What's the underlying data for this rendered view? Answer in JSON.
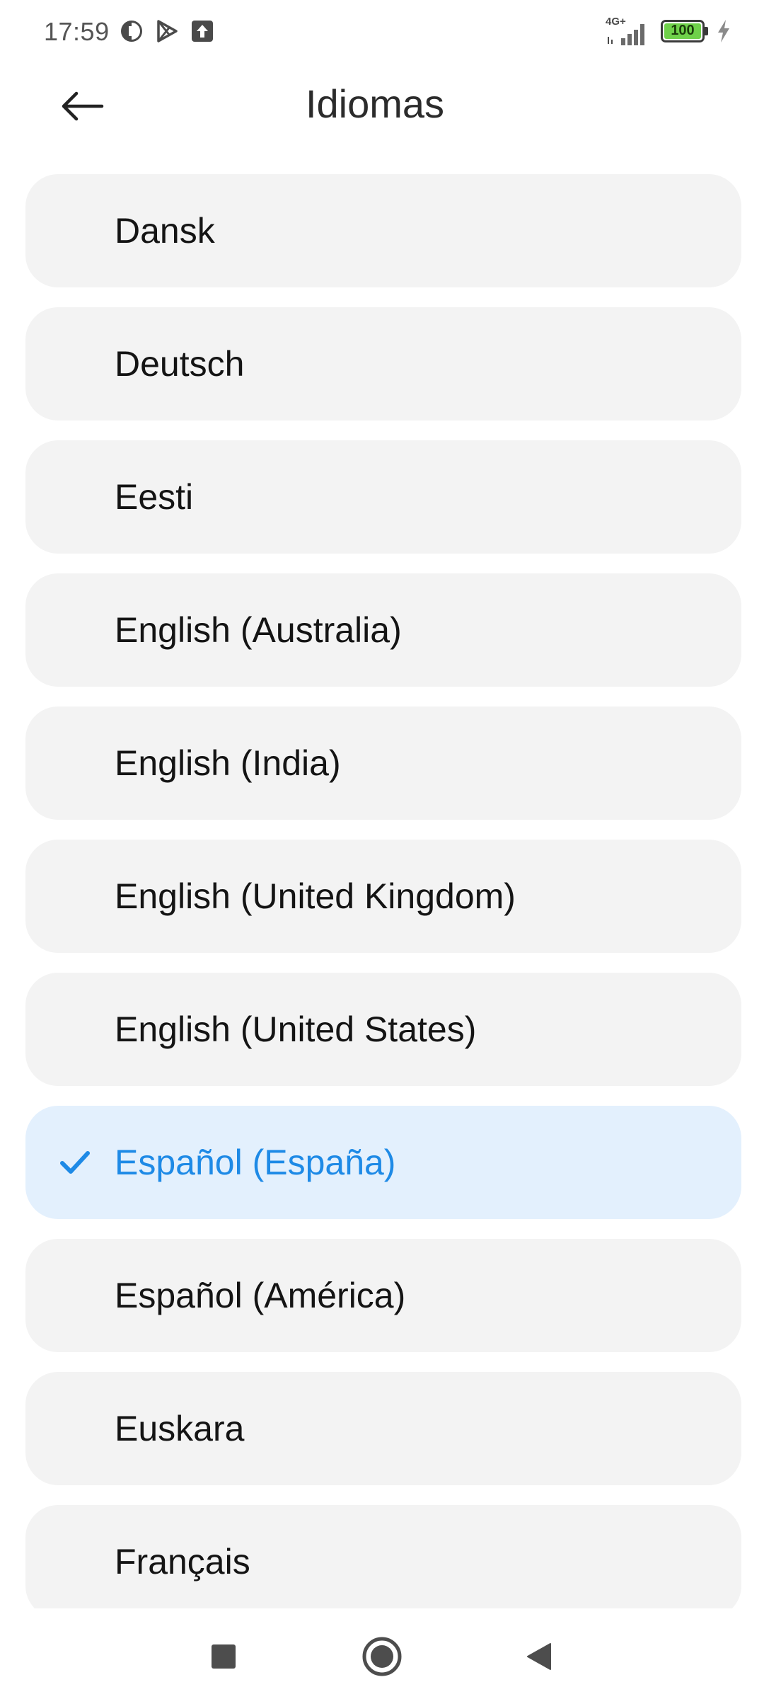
{
  "status_bar": {
    "time": "17:59",
    "network": "4G+",
    "battery": "100",
    "icons": [
      "app-notification-icon",
      "play-store-icon",
      "upload-icon",
      "signal-icon",
      "battery-icon",
      "charging-icon"
    ]
  },
  "header": {
    "title": "Idiomas",
    "back_icon": "arrow-left-icon"
  },
  "languages": [
    {
      "label": "Dansk",
      "selected": false
    },
    {
      "label": "Deutsch",
      "selected": false
    },
    {
      "label": "Eesti",
      "selected": false
    },
    {
      "label": "English (Australia)",
      "selected": false
    },
    {
      "label": "English (India)",
      "selected": false
    },
    {
      "label": "English (United Kingdom)",
      "selected": false
    },
    {
      "label": "English (United States)",
      "selected": false
    },
    {
      "label": "Español (España)",
      "selected": true
    },
    {
      "label": "Español (América)",
      "selected": false
    },
    {
      "label": "Euskara",
      "selected": false
    },
    {
      "label": "Français",
      "selected": false
    }
  ],
  "nav_bar": {
    "icons": [
      "recents-square-icon",
      "home-circle-icon",
      "back-triangle-icon"
    ]
  },
  "colors": {
    "accent": "#1e8ae6",
    "selected_bg": "#e3f0fd",
    "item_bg": "#f3f3f3",
    "battery_fill": "#6fd14a"
  }
}
